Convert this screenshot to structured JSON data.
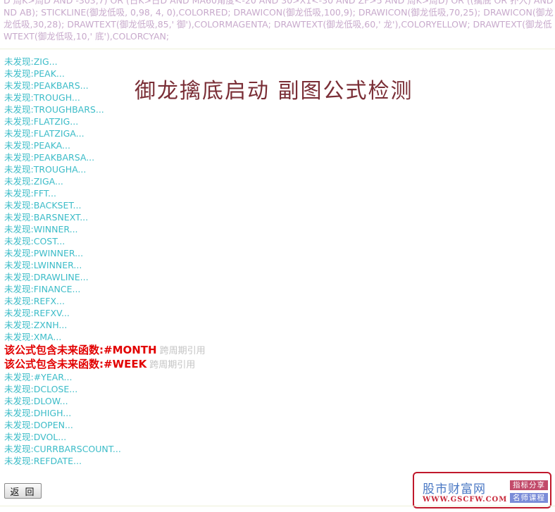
{
  "formula_lines": [
    "D 周K>周D AND -303,7) OR (日K>日D AND MA60角度<-20 AND 30>X1<-30 AND ZF>5 AND 周K>周D) OR ((擒底 OR 扑入) AND",
    "ND AB); STICKLINE(御龙低吸, 0,98, 4, 0),COLORRED; DRAWICON(御龙低吸,100,9); DRAWICON(御龙低吸,70,25); DRAWICON(御龙",
    "龙低吸,30,28); DRAWTEXT(御龙低吸,85,' 御'),COLORMAGENTA; DRAWTEXT(御龙低吸,60,' 龙'),COLORYELLOW; DRAWTEXT(御龙低",
    "WTEXT(御龙低吸,10,' 底'),COLORCYAN;"
  ],
  "title": "御龙擒底启动 副图公式检测",
  "results_before": [
    "未发现:ZIG...",
    "未发现:PEAK...",
    "未发现:PEAKBARS...",
    "未发现:TROUGH...",
    "未发现:TROUGHBARS...",
    "未发现:FLATZIG...",
    "未发现:FLATZIGA...",
    "未发现:PEAKA...",
    "未发现:PEAKBARSA...",
    "未发现:TROUGHA...",
    "未发现:ZIGA...",
    "未发现:FFT...",
    "未发现:BACKSET...",
    "未发现:BARSNEXT...",
    "未发现:WINNER...",
    "未发现:COST...",
    "未发现:PWINNER...",
    "未发现:LWINNER...",
    "未发现:DRAWLINE...",
    "未发现:FINANCE...",
    "未发现:REFX...",
    "未发现:REFXV...",
    "未发现:ZXNH...",
    "未发现:XMA..."
  ],
  "warnings": [
    {
      "text": "该公式包含未来函数:#MONTH",
      "note": "跨周期引用"
    },
    {
      "text": "该公式包含未来函数:#WEEK",
      "note": "跨周期引用"
    }
  ],
  "results_after": [
    "未发现:#YEAR...",
    "未发现:DCLOSE...",
    "未发现:DLOW...",
    "未发现:DHIGH...",
    "未发现:DOPEN...",
    "未发现:DVOL...",
    "未发现:CURRBARSCOUNT...",
    "未发现:REFDATE..."
  ],
  "back_button": "返 回",
  "logo": {
    "name": "股市财富网",
    "url": "WWW.GSCFW.COM",
    "tag1": "指标分享",
    "tag2": "名师课程"
  },
  "colors": {
    "formula_text": "#c8aacc",
    "title": "#7a2e36",
    "result_text": "#3cbcc8",
    "warning_text": "#e20000",
    "warning_note": "#c4c4c4",
    "logo_border": "#c0182c"
  }
}
